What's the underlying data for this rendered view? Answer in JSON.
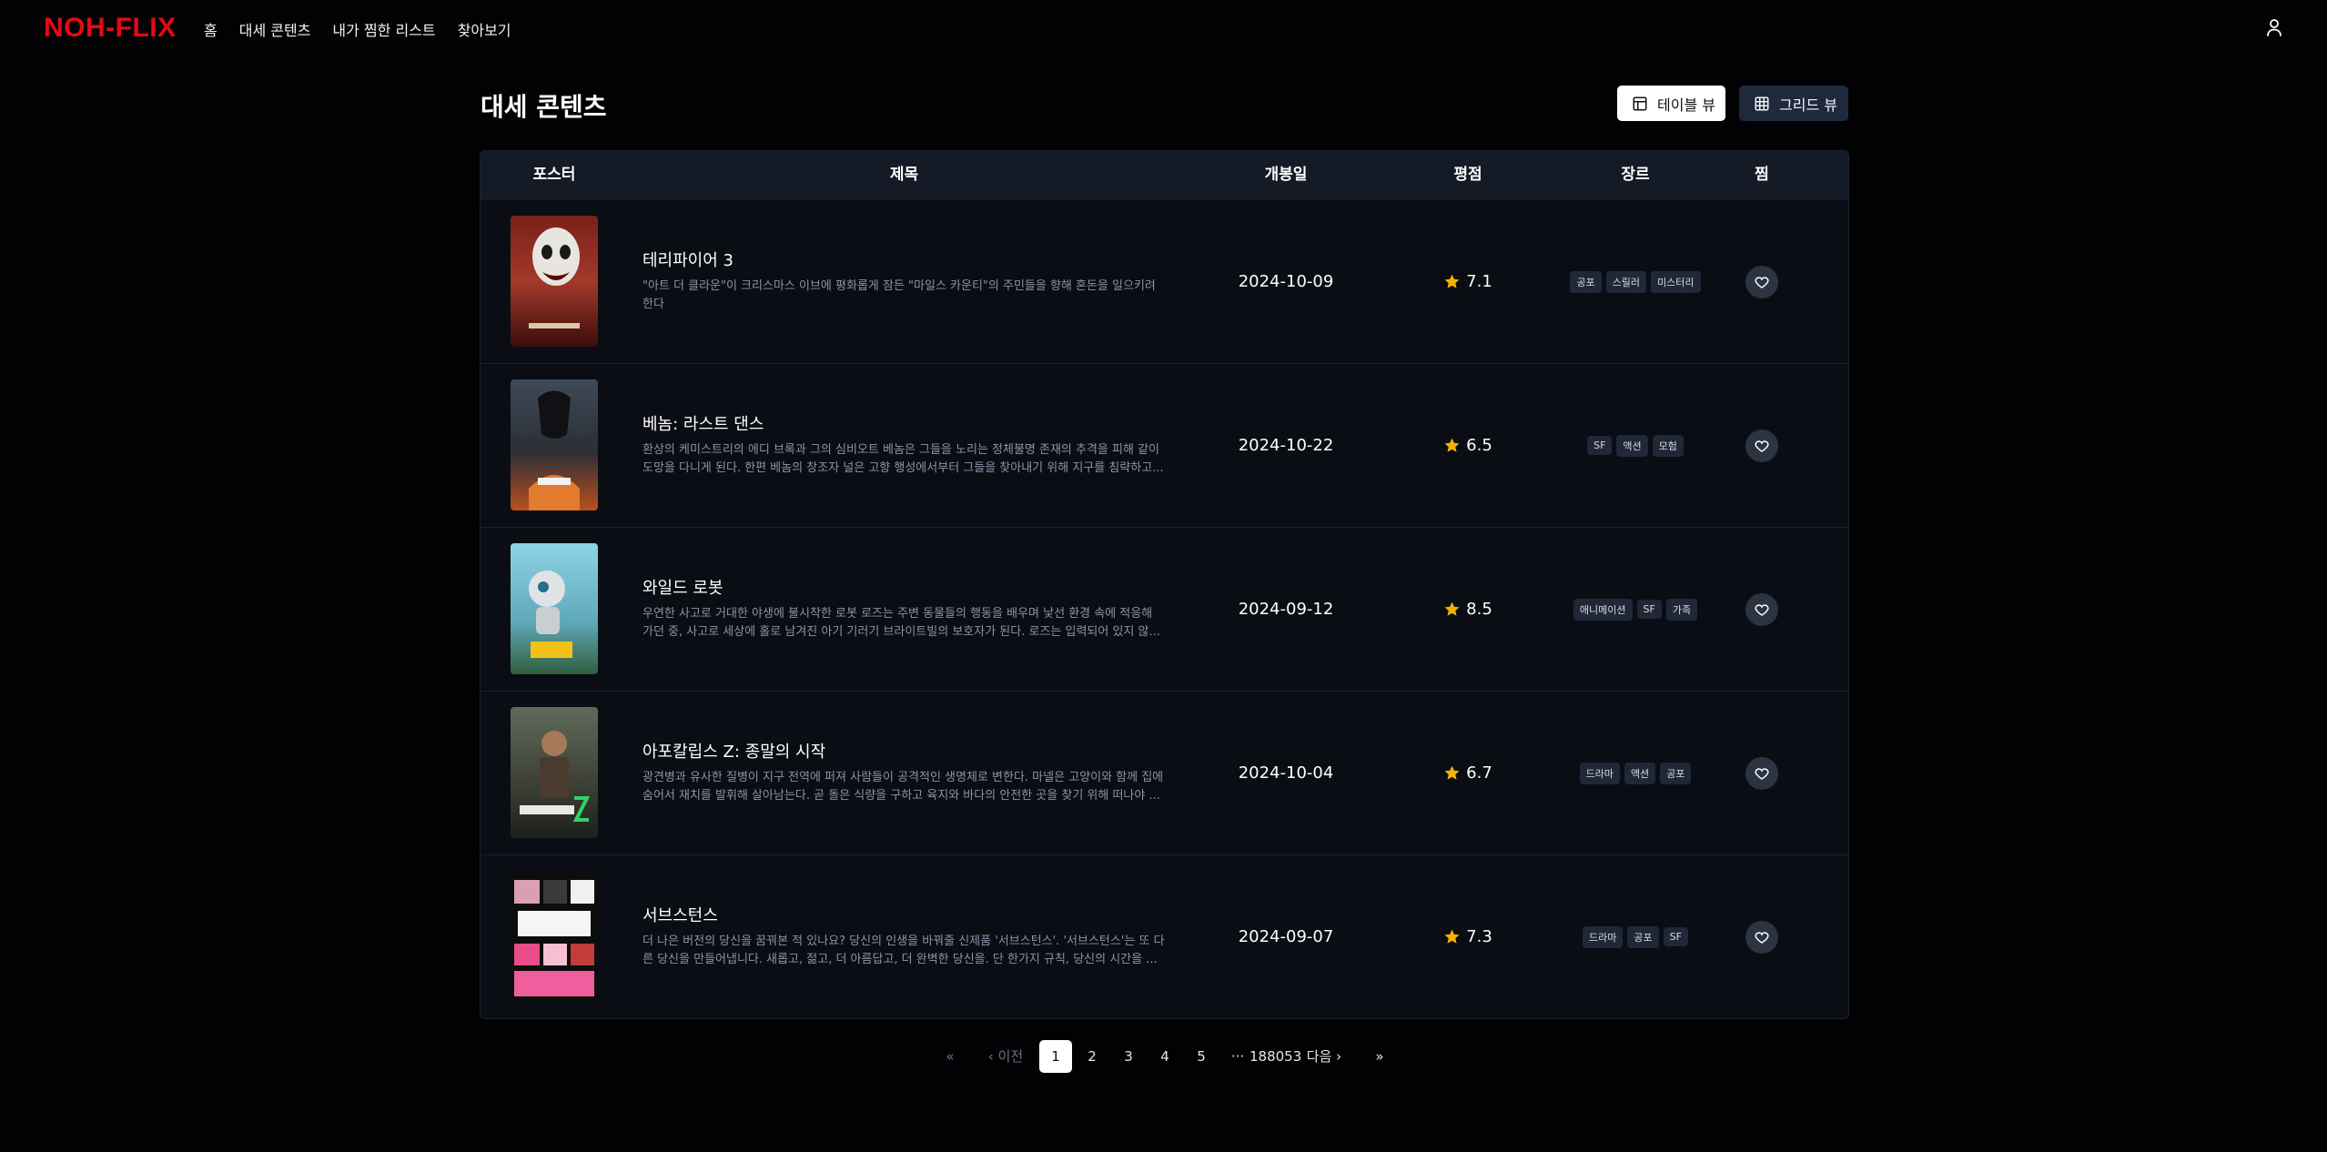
{
  "nav": {
    "logo": "NOH-FLIX",
    "links": [
      "홈",
      "대세 콘텐츠",
      "내가 찜한 리스트",
      "찾아보기"
    ],
    "user_icon": "user-icon"
  },
  "page": {
    "title": "대세 콘텐츠",
    "table_view_label": "테이블 뷰",
    "grid_view_label": "그리드 뷰",
    "active_view": "table"
  },
  "table": {
    "headers": {
      "poster": "포스터",
      "title": "제목",
      "release": "개봉일",
      "rating": "평점",
      "genre": "장르",
      "favorite": "찜"
    },
    "rows": [
      {
        "title": "테리파이어 3",
        "description": "\"아트 더 클라운\"이 크리스마스 이브에 평화롭게 잠든 \"마일스 카운티\"의 주민들을 향해 혼돈을 일으키려 한다",
        "release": "2024-10-09",
        "rating": "7.1",
        "genres": [
          "공포",
          "스릴러",
          "미스터리"
        ]
      },
      {
        "title": "베놈: 라스트 댄스",
        "description": "환상의 케미스트리의 에디 브록과 그의 심비오트 베놈은 그들을 노리는 정체불명 존재의 추격을 피해 같이 도망을 다니게 된다. 한편 베놈의 창조자 널은 고향 행성에서부터 그들을 찾아내기 위해 지구를 침략하고...",
        "release": "2024-10-22",
        "rating": "6.5",
        "genres": [
          "SF",
          "액션",
          "모험"
        ]
      },
      {
        "title": "와일드 로봇",
        "description": "우연한 사고로 거대한 야생에 불시착한 로봇 로즈는 주변 동물들의 행동을 배우며 낯선 환경 속에 적응해 가던 중, 사고로 세상에 홀로 남겨진 아기 기러기 브라이트빌의 보호자가 된다. 로즈는 입력되어 있지 않...",
        "release": "2024-09-12",
        "rating": "8.5",
        "genres": [
          "애니메이션",
          "SF",
          "가족"
        ]
      },
      {
        "title": "아포칼립스 Z: 종말의 시작",
        "description": "광견병과 유사한 질병이 지구 전역에 퍼져 사람들이 공격적인 생명체로 변한다. 마넬은 고양이와 함께 집에 숨어서 재치를 발휘해 살아남는다. 곧 돌은 식량을 구하고 육지와 바다의 안전한 곳을 찾기 위해 떠나야 ...",
        "release": "2024-10-04",
        "rating": "6.7",
        "genres": [
          "드라마",
          "액션",
          "공포"
        ]
      },
      {
        "title": "서브스턴스",
        "description": "더 나은 버전의 당신을 꿈꿔본 적 있나요? 당신의 인생을 바꿔줄 신제품 '서브스턴스'. '서브스턴스'는 또 다른 당신을 만들어냅니다. 새롭고, 젊고, 더 아름답고, 더 완벽한 당신을. 단 한가지 규칙, 당신의 시간을 ...",
        "release": "2024-09-07",
        "rating": "7.3",
        "genres": [
          "드라마",
          "공포",
          "SF"
        ]
      }
    ]
  },
  "pagination": {
    "first": "«",
    "prev": "이전",
    "pages": [
      "1",
      "2",
      "3",
      "4",
      "5"
    ],
    "current": "1",
    "ellipsis": "···",
    "last_page": "188053",
    "next": "다음",
    "last": "»"
  },
  "colors": {
    "brand": "#e50914",
    "background": "#020204",
    "star": "#f5b301"
  }
}
